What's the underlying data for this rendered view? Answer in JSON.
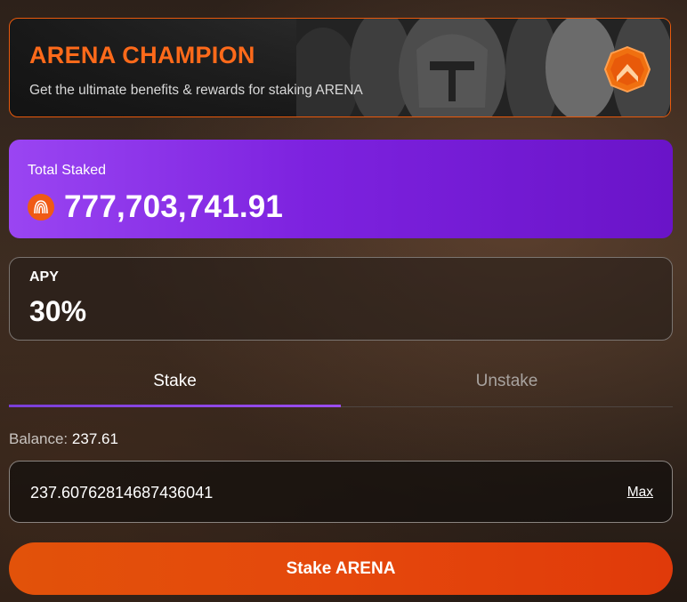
{
  "banner": {
    "title": "ARENA CHAMPION",
    "subtitle": "Get the ultimate benefits & rewards for staking ARENA",
    "badge_icon": "arena-chevron-badge-icon",
    "accent": "#ff6a1a"
  },
  "total_staked": {
    "label": "Total Staked",
    "value": "777,703,741.91",
    "token_icon": "arena-token-icon"
  },
  "apy": {
    "label": "APY",
    "value": "30%"
  },
  "tabs": {
    "items": [
      {
        "label": "Stake",
        "active": true
      },
      {
        "label": "Unstake",
        "active": false
      }
    ]
  },
  "balance": {
    "label": "Balance:",
    "value": "237.61"
  },
  "amount_input": {
    "value": "237.60762814687436041",
    "max_label": "Max"
  },
  "submit": {
    "label": "Stake ARENA"
  },
  "colors": {
    "primary_orange": "#e2520a",
    "purple": "#7d22df",
    "background": "#2d211a"
  }
}
